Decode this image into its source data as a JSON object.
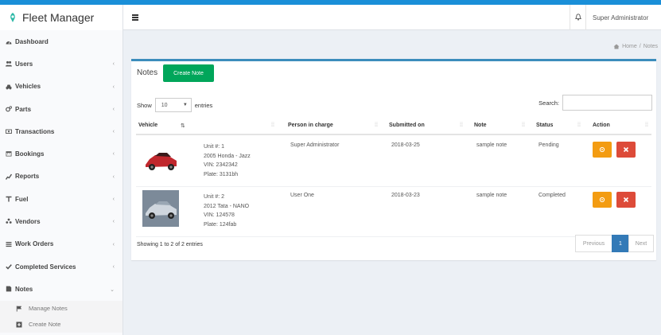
{
  "app": {
    "title": "Fleet Manager"
  },
  "header": {
    "user_name": "Super Administrator"
  },
  "breadcrumb": {
    "home": "Home",
    "separator": "/",
    "current": "Notes"
  },
  "sidebar": {
    "items": [
      {
        "label": "Dashboard",
        "icon": "dashboard-icon",
        "has_chevron": false
      },
      {
        "label": "Users",
        "icon": "users-icon",
        "has_chevron": true
      },
      {
        "label": "Vehicles",
        "icon": "car-icon",
        "has_chevron": true
      },
      {
        "label": "Parts",
        "icon": "cogs-icon",
        "has_chevron": true
      },
      {
        "label": "Transactions",
        "icon": "money-icon",
        "has_chevron": true
      },
      {
        "label": "Bookings",
        "icon": "calendar-icon",
        "has_chevron": true
      },
      {
        "label": "Reports",
        "icon": "chart-icon",
        "has_chevron": true
      },
      {
        "label": "Fuel",
        "icon": "fuel-icon",
        "has_chevron": true
      },
      {
        "label": "Vendors",
        "icon": "vendors-icon",
        "has_chevron": true
      },
      {
        "label": "Work Orders",
        "icon": "list-icon",
        "has_chevron": true
      },
      {
        "label": "Completed Services",
        "icon": "check-icon",
        "has_chevron": true
      },
      {
        "label": "Notes",
        "icon": "notes-icon",
        "has_chevron": true
      }
    ],
    "submenu": [
      {
        "label": "Manage Notes",
        "icon": "flag-icon"
      },
      {
        "label": "Create Note",
        "icon": "plus-square-icon"
      }
    ]
  },
  "notes_box": {
    "title": "Notes",
    "create_button": "Create Note",
    "show_label": "Show",
    "entries_value": "10",
    "entries_label": "entries",
    "search_label": "Search:",
    "search_value": "",
    "columns": [
      "Vehicle",
      "",
      "Person in charge",
      "Submitted on",
      "Note",
      "Status",
      "Action"
    ],
    "rows": [
      {
        "vehicle_lines": [
          "Unit #: 1",
          "2005 Honda - Jazz",
          "VIN: 2342342",
          "Plate: 3131bh"
        ],
        "person": "Super Administrator",
        "submitted": "2018-03-25",
        "note": "sample note",
        "status": "Pending",
        "car_color": "#c0272d"
      },
      {
        "vehicle_lines": [
          "Unit #: 2",
          "2012 Tata - NANO",
          "VIN: 124578",
          "Plate: 124fab"
        ],
        "person": "User One",
        "submitted": "2018-03-23",
        "note": "sample note",
        "status": "Completed",
        "car_color": "#cfd6de"
      }
    ],
    "info": "Showing 1 to 2 of 2 entries",
    "pagination": {
      "previous": "Previous",
      "page": "1",
      "next": "Next"
    }
  },
  "colors": {
    "accent_blue": "#3c8dbc",
    "create_green": "#00a65a",
    "edit_orange": "#f39c12",
    "delete_red": "#dd4b39",
    "window_border": "#1a8fd8"
  }
}
